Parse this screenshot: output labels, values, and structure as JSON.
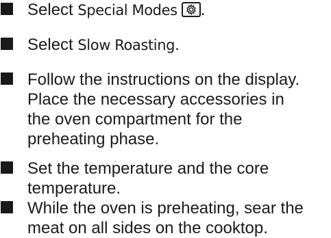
{
  "steps": [
    {
      "prefix": "Select ",
      "term": "Special Modes",
      "icon": "special-modes-icon",
      "suffix": "."
    },
    {
      "prefix": "Select ",
      "term": "Slow Roasting",
      "suffix": "."
    },
    {
      "line1": "Follow the instructions on the display.",
      "line2": "Place the necessary accessories in",
      "line3": "the oven compartment for the",
      "line4": "preheating phase."
    },
    {
      "line1": "Set the temperature and the core",
      "line2": "temperature."
    },
    {
      "line1": "While the oven is preheating, sear the",
      "line2": "meat on all sides on the cooktop."
    }
  ],
  "colors": {
    "text": "#1a1a1a",
    "background": "#ffffff"
  }
}
